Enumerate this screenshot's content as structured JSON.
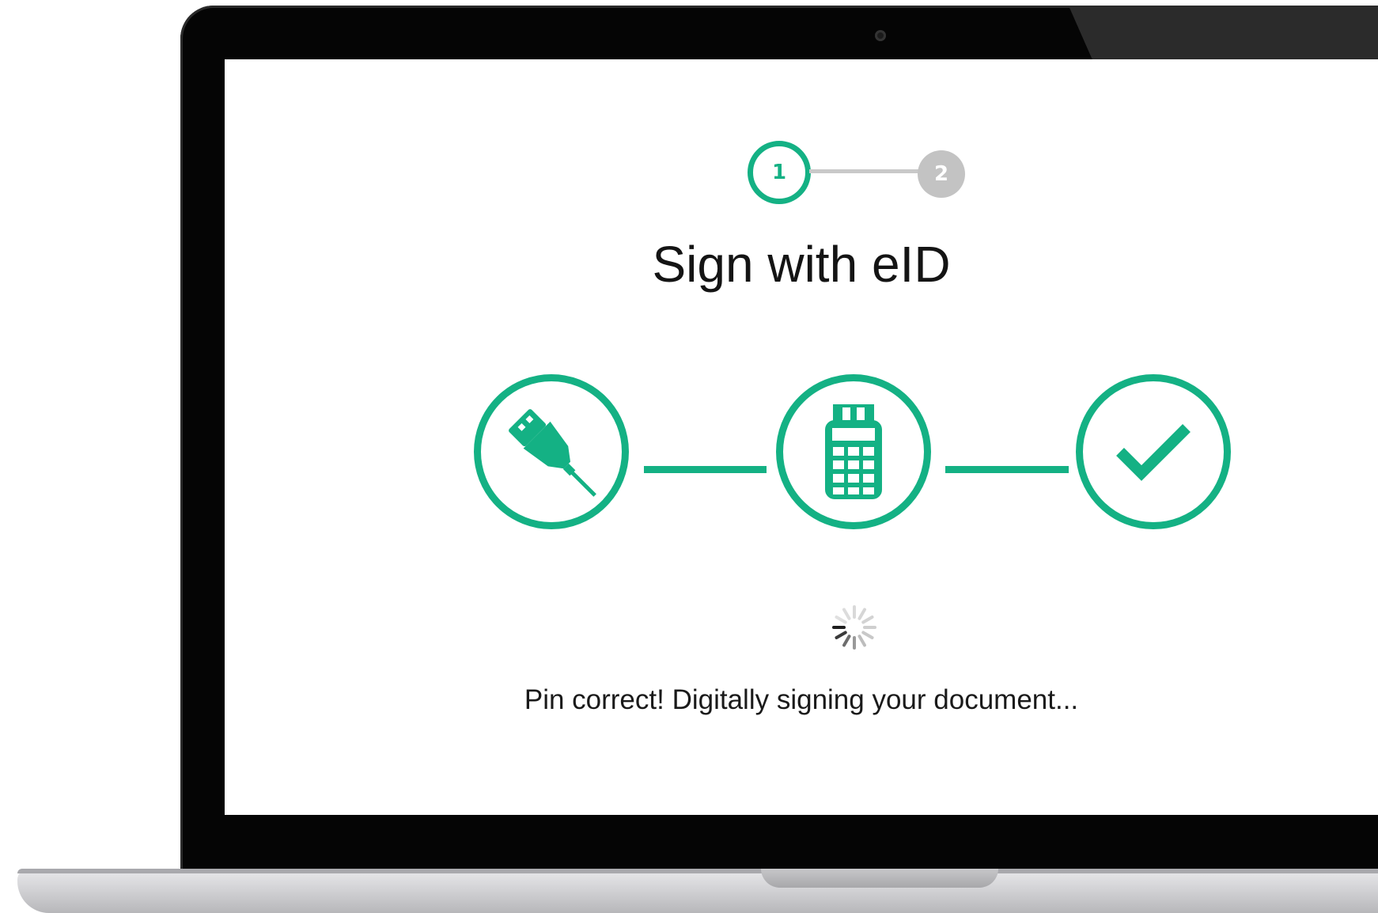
{
  "stepper": {
    "steps": [
      {
        "label": "1",
        "state": "active"
      },
      {
        "label": "2",
        "state": "inactive"
      }
    ]
  },
  "title": "Sign with eID",
  "process": {
    "icons": [
      "usb-icon",
      "card-reader-icon",
      "checkmark-icon"
    ]
  },
  "status": {
    "message": "Pin correct! Digitally signing your document..."
  },
  "colors": {
    "accent": "#14b184",
    "inactive": "#c3c3c3",
    "text": "#141414"
  }
}
